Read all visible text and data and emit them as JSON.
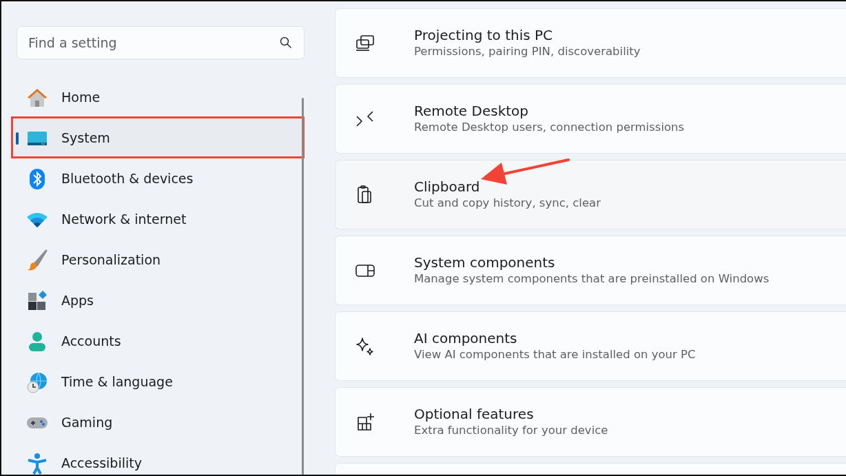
{
  "search": {
    "placeholder": "Find a setting"
  },
  "sidebar": {
    "items": [
      {
        "label": "Home",
        "selected": false,
        "annotated": false
      },
      {
        "label": "System",
        "selected": true,
        "annotated": true
      },
      {
        "label": "Bluetooth & devices",
        "selected": false,
        "annotated": false
      },
      {
        "label": "Network & internet",
        "selected": false,
        "annotated": false
      },
      {
        "label": "Personalization",
        "selected": false,
        "annotated": false
      },
      {
        "label": "Apps",
        "selected": false,
        "annotated": false
      },
      {
        "label": "Accounts",
        "selected": false,
        "annotated": false
      },
      {
        "label": "Time & language",
        "selected": false,
        "annotated": false
      },
      {
        "label": "Gaming",
        "selected": false,
        "annotated": false
      },
      {
        "label": "Accessibility",
        "selected": false,
        "annotated": false
      }
    ]
  },
  "settings": [
    {
      "title": "Projecting to this PC",
      "description": "Permissions, pairing PIN, discoverability",
      "hovered": false,
      "arrow": false
    },
    {
      "title": "Remote Desktop",
      "description": "Remote Desktop users, connection permissions",
      "hovered": false,
      "arrow": false
    },
    {
      "title": "Clipboard",
      "description": "Cut and copy history, sync, clear",
      "hovered": true,
      "arrow": true
    },
    {
      "title": "System components",
      "description": "Manage system components that are preinstalled on Windows",
      "hovered": false,
      "arrow": false
    },
    {
      "title": "AI components",
      "description": "View AI components that are installed on your PC",
      "hovered": false,
      "arrow": false
    },
    {
      "title": "Optional features",
      "description": "Extra functionality for your device",
      "hovered": false,
      "arrow": false
    }
  ]
}
